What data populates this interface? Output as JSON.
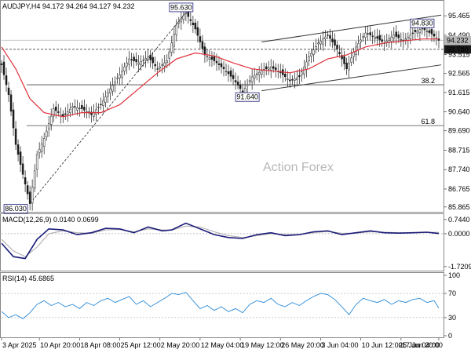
{
  "chart_data": {
    "type": "candlestick",
    "symbol_header": "AUDJPY,H4  94.172 94.264 94.127 94.232",
    "watermark": "Action Forex",
    "x_ticks": [
      "3 Apr 2025",
      "10 Apr 20:00",
      "18 Apr 08:00",
      "25 Apr 12:00",
      "2 May 20:00",
      "12 May 04:00",
      "19 May 12:00",
      "26 May 20:00",
      "3 Jun 04:00",
      "10 Jun 12:00",
      "17 Jun 20:00",
      "25 Jun 04:00"
    ],
    "price_axis": {
      "ticks": [
        95.465,
        94.49,
        93.515,
        92.565,
        91.615,
        90.64,
        89.69,
        88.715,
        87.74,
        86.765,
        85.865
      ],
      "range": [
        85.7,
        96.1
      ]
    },
    "price_tags": [
      {
        "label": "94.232",
        "value": 94.232,
        "bg": "#b8b8b8"
      },
      {
        "label": "93.780",
        "value": 93.78,
        "bg": "#1a1a1a"
      }
    ],
    "fib_levels": [
      {
        "label": "38.2",
        "value": 92.0
      },
      {
        "label": "61.8",
        "value": 89.95
      }
    ],
    "point_labels": [
      {
        "label": "95.630",
        "value": 95.63,
        "at": "12 May"
      },
      {
        "label": "86.030",
        "value": 86.03,
        "at": "9 Apr"
      },
      {
        "label": "91.640",
        "value": 91.64,
        "at": "21 May"
      },
      {
        "label": "94.830",
        "value": 94.83,
        "at": "24 Jun"
      }
    ],
    "price_series": [
      {
        "t": 0,
        "v": 93.0
      },
      {
        "t": 3,
        "v": 91.5
      },
      {
        "t": 6,
        "v": 89.0
      },
      {
        "t": 9,
        "v": 87.5
      },
      {
        "t": 12,
        "v": 86.03
      },
      {
        "t": 15,
        "v": 88.5
      },
      {
        "t": 18,
        "v": 89.3
      },
      {
        "t": 22,
        "v": 90.8
      },
      {
        "t": 26,
        "v": 90.4
      },
      {
        "t": 30,
        "v": 90.9
      },
      {
        "t": 34,
        "v": 90.8
      },
      {
        "t": 38,
        "v": 90.5
      },
      {
        "t": 42,
        "v": 91.0
      },
      {
        "t": 46,
        "v": 91.8
      },
      {
        "t": 50,
        "v": 92.5
      },
      {
        "t": 54,
        "v": 93.3
      },
      {
        "t": 58,
        "v": 93.1
      },
      {
        "t": 62,
        "v": 93.4
      },
      {
        "t": 66,
        "v": 92.8
      },
      {
        "t": 70,
        "v": 93.2
      },
      {
        "t": 74,
        "v": 95.0
      },
      {
        "t": 78,
        "v": 95.63
      },
      {
        "t": 82,
        "v": 94.8
      },
      {
        "t": 86,
        "v": 93.5
      },
      {
        "t": 90,
        "v": 93.2
      },
      {
        "t": 94,
        "v": 92.8
      },
      {
        "t": 98,
        "v": 92.3
      },
      {
        "t": 102,
        "v": 91.64
      },
      {
        "t": 106,
        "v": 92.4
      },
      {
        "t": 110,
        "v": 92.7
      },
      {
        "t": 114,
        "v": 92.9
      },
      {
        "t": 118,
        "v": 92.6
      },
      {
        "t": 122,
        "v": 92.2
      },
      {
        "t": 126,
        "v": 92.4
      },
      {
        "t": 130,
        "v": 93.4
      },
      {
        "t": 134,
        "v": 94.1
      },
      {
        "t": 138,
        "v": 94.5
      },
      {
        "t": 142,
        "v": 93.8
      },
      {
        "t": 146,
        "v": 92.8
      },
      {
        "t": 150,
        "v": 93.9
      },
      {
        "t": 154,
        "v": 94.6
      },
      {
        "t": 158,
        "v": 94.4
      },
      {
        "t": 162,
        "v": 94.1
      },
      {
        "t": 166,
        "v": 94.5
      },
      {
        "t": 170,
        "v": 94.2
      },
      {
        "t": 174,
        "v": 94.6
      },
      {
        "t": 178,
        "v": 94.83
      },
      {
        "t": 182,
        "v": 94.55
      },
      {
        "t": 185,
        "v": 94.23
      }
    ],
    "ma_series": [
      {
        "t": 0,
        "v": 93.9
      },
      {
        "t": 6,
        "v": 92.8
      },
      {
        "t": 12,
        "v": 91.3
      },
      {
        "t": 18,
        "v": 90.6
      },
      {
        "t": 26,
        "v": 90.4
      },
      {
        "t": 34,
        "v": 90.6
      },
      {
        "t": 42,
        "v": 90.6
      },
      {
        "t": 50,
        "v": 91.0
      },
      {
        "t": 58,
        "v": 91.8
      },
      {
        "t": 66,
        "v": 92.6
      },
      {
        "t": 74,
        "v": 93.3
      },
      {
        "t": 82,
        "v": 93.6
      },
      {
        "t": 90,
        "v": 93.45
      },
      {
        "t": 98,
        "v": 93.1
      },
      {
        "t": 106,
        "v": 92.8
      },
      {
        "t": 114,
        "v": 92.7
      },
      {
        "t": 122,
        "v": 92.6
      },
      {
        "t": 130,
        "v": 92.8
      },
      {
        "t": 138,
        "v": 93.3
      },
      {
        "t": 146,
        "v": 93.5
      },
      {
        "t": 154,
        "v": 93.9
      },
      {
        "t": 162,
        "v": 94.1
      },
      {
        "t": 170,
        "v": 94.2
      },
      {
        "t": 178,
        "v": 94.3
      },
      {
        "t": 185,
        "v": 94.3
      }
    ],
    "channel_lines": [
      {
        "name": "upper",
        "from": {
          "t": 110,
          "v": 94.15
        },
        "to": {
          "t": 186,
          "v": 95.5
        }
      },
      {
        "name": "lower",
        "from": {
          "t": 110,
          "v": 91.7
        },
        "to": {
          "t": 186,
          "v": 93.0
        }
      }
    ],
    "trend_line": {
      "from": {
        "t": 12,
        "v": 86.03
      },
      "to": {
        "t": 78,
        "v": 95.63
      }
    },
    "macd": {
      "header": "MACD(12,26,9) 0.0140 0.0699",
      "ticks": [
        {
          "label": "0.7440",
          "value": 0.744
        },
        {
          "label": "0.0000",
          "value": 0.0
        },
        {
          "label": "-1.7209",
          "value": -1.7209
        }
      ],
      "range": [
        -1.85,
        0.9
      ],
      "macd_line": [
        {
          "t": 0,
          "v": -0.5
        },
        {
          "t": 5,
          "v": -1.2
        },
        {
          "t": 10,
          "v": -1.3
        },
        {
          "t": 15,
          "v": -0.3
        },
        {
          "t": 20,
          "v": 0.25
        },
        {
          "t": 26,
          "v": 0.2
        },
        {
          "t": 32,
          "v": -0.05
        },
        {
          "t": 38,
          "v": 0.05
        },
        {
          "t": 44,
          "v": 0.28
        },
        {
          "t": 50,
          "v": 0.25
        },
        {
          "t": 56,
          "v": 0.05
        },
        {
          "t": 62,
          "v": 0.35
        },
        {
          "t": 68,
          "v": 0.15
        },
        {
          "t": 72,
          "v": 0.2
        },
        {
          "t": 78,
          "v": 0.55
        },
        {
          "t": 84,
          "v": 0.25
        },
        {
          "t": 90,
          "v": -0.05
        },
        {
          "t": 96,
          "v": -0.2
        },
        {
          "t": 102,
          "v": -0.25
        },
        {
          "t": 108,
          "v": -0.05
        },
        {
          "t": 114,
          "v": 0.05
        },
        {
          "t": 120,
          "v": -0.1
        },
        {
          "t": 126,
          "v": -0.05
        },
        {
          "t": 132,
          "v": 0.1
        },
        {
          "t": 138,
          "v": 0.15
        },
        {
          "t": 144,
          "v": -0.05
        },
        {
          "t": 150,
          "v": 0.05
        },
        {
          "t": 156,
          "v": 0.15
        },
        {
          "t": 162,
          "v": 0.05
        },
        {
          "t": 168,
          "v": 0.03
        },
        {
          "t": 174,
          "v": 0.05
        },
        {
          "t": 180,
          "v": 0.08
        },
        {
          "t": 185,
          "v": 0.01
        }
      ],
      "signal_line": [
        {
          "t": 0,
          "v": -0.3
        },
        {
          "t": 5,
          "v": -0.9
        },
        {
          "t": 10,
          "v": -1.2
        },
        {
          "t": 15,
          "v": -0.7
        },
        {
          "t": 20,
          "v": 0.0
        },
        {
          "t": 26,
          "v": 0.15
        },
        {
          "t": 32,
          "v": 0.05
        },
        {
          "t": 38,
          "v": 0.02
        },
        {
          "t": 44,
          "v": 0.2
        },
        {
          "t": 50,
          "v": 0.22
        },
        {
          "t": 56,
          "v": 0.1
        },
        {
          "t": 62,
          "v": 0.25
        },
        {
          "t": 68,
          "v": 0.2
        },
        {
          "t": 72,
          "v": 0.18
        },
        {
          "t": 78,
          "v": 0.4
        },
        {
          "t": 84,
          "v": 0.35
        },
        {
          "t": 90,
          "v": 0.1
        },
        {
          "t": 96,
          "v": -0.1
        },
        {
          "t": 102,
          "v": -0.2
        },
        {
          "t": 108,
          "v": -0.1
        },
        {
          "t": 114,
          "v": 0.0
        },
        {
          "t": 120,
          "v": -0.05
        },
        {
          "t": 126,
          "v": -0.05
        },
        {
          "t": 132,
          "v": 0.05
        },
        {
          "t": 138,
          "v": 0.12
        },
        {
          "t": 144,
          "v": 0.02
        },
        {
          "t": 150,
          "v": 0.03
        },
        {
          "t": 156,
          "v": 0.1
        },
        {
          "t": 162,
          "v": 0.08
        },
        {
          "t": 168,
          "v": 0.05
        },
        {
          "t": 174,
          "v": 0.05
        },
        {
          "t": 180,
          "v": 0.07
        },
        {
          "t": 185,
          "v": 0.07
        }
      ]
    },
    "rsi": {
      "header": "RSI(14) 45.6865",
      "ticks": [
        {
          "label": "100",
          "value": 100
        },
        {
          "label": "70",
          "value": 70
        },
        {
          "label": "30",
          "value": 30
        },
        {
          "label": "0",
          "value": 0
        }
      ],
      "series": [
        {
          "t": 0,
          "v": 40
        },
        {
          "t": 3,
          "v": 30
        },
        {
          "t": 6,
          "v": 35
        },
        {
          "t": 9,
          "v": 28
        },
        {
          "t": 12,
          "v": 38
        },
        {
          "t": 15,
          "v": 52
        },
        {
          "t": 18,
          "v": 58
        },
        {
          "t": 21,
          "v": 50
        },
        {
          "t": 24,
          "v": 55
        },
        {
          "t": 27,
          "v": 48
        },
        {
          "t": 30,
          "v": 52
        },
        {
          "t": 33,
          "v": 45
        },
        {
          "t": 36,
          "v": 55
        },
        {
          "t": 39,
          "v": 50
        },
        {
          "t": 42,
          "v": 58
        },
        {
          "t": 45,
          "v": 62
        },
        {
          "t": 48,
          "v": 55
        },
        {
          "t": 51,
          "v": 60
        },
        {
          "t": 54,
          "v": 65
        },
        {
          "t": 57,
          "v": 52
        },
        {
          "t": 60,
          "v": 58
        },
        {
          "t": 63,
          "v": 48
        },
        {
          "t": 66,
          "v": 55
        },
        {
          "t": 69,
          "v": 62
        },
        {
          "t": 72,
          "v": 70
        },
        {
          "t": 75,
          "v": 68
        },
        {
          "t": 78,
          "v": 72
        },
        {
          "t": 81,
          "v": 58
        },
        {
          "t": 84,
          "v": 45
        },
        {
          "t": 87,
          "v": 50
        },
        {
          "t": 90,
          "v": 42
        },
        {
          "t": 93,
          "v": 48
        },
        {
          "t": 96,
          "v": 40
        },
        {
          "t": 99,
          "v": 45
        },
        {
          "t": 102,
          "v": 38
        },
        {
          "t": 105,
          "v": 52
        },
        {
          "t": 108,
          "v": 58
        },
        {
          "t": 111,
          "v": 55
        },
        {
          "t": 114,
          "v": 62
        },
        {
          "t": 117,
          "v": 52
        },
        {
          "t": 120,
          "v": 48
        },
        {
          "t": 123,
          "v": 55
        },
        {
          "t": 126,
          "v": 50
        },
        {
          "t": 129,
          "v": 58
        },
        {
          "t": 132,
          "v": 65
        },
        {
          "t": 135,
          "v": 70
        },
        {
          "t": 138,
          "v": 68
        },
        {
          "t": 141,
          "v": 60
        },
        {
          "t": 144,
          "v": 48
        },
        {
          "t": 147,
          "v": 35
        },
        {
          "t": 150,
          "v": 52
        },
        {
          "t": 153,
          "v": 62
        },
        {
          "t": 156,
          "v": 58
        },
        {
          "t": 159,
          "v": 55
        },
        {
          "t": 162,
          "v": 60
        },
        {
          "t": 165,
          "v": 52
        },
        {
          "t": 168,
          "v": 58
        },
        {
          "t": 171,
          "v": 55
        },
        {
          "t": 174,
          "v": 60
        },
        {
          "t": 177,
          "v": 62
        },
        {
          "t": 180,
          "v": 55
        },
        {
          "t": 183,
          "v": 58
        },
        {
          "t": 185,
          "v": 45.7
        }
      ]
    },
    "colors": {
      "candle_up": "#1a1a1a",
      "candle_down": "#1a1a1a",
      "price_line": "#2a2a2a",
      "ma": "#e0303a",
      "channel": "#333333",
      "macd_line": "#1c1c7a",
      "macd_signal": "#b0b0b0",
      "rsi": "#2a8ad8",
      "label_text": "#1c1c7a"
    }
  }
}
